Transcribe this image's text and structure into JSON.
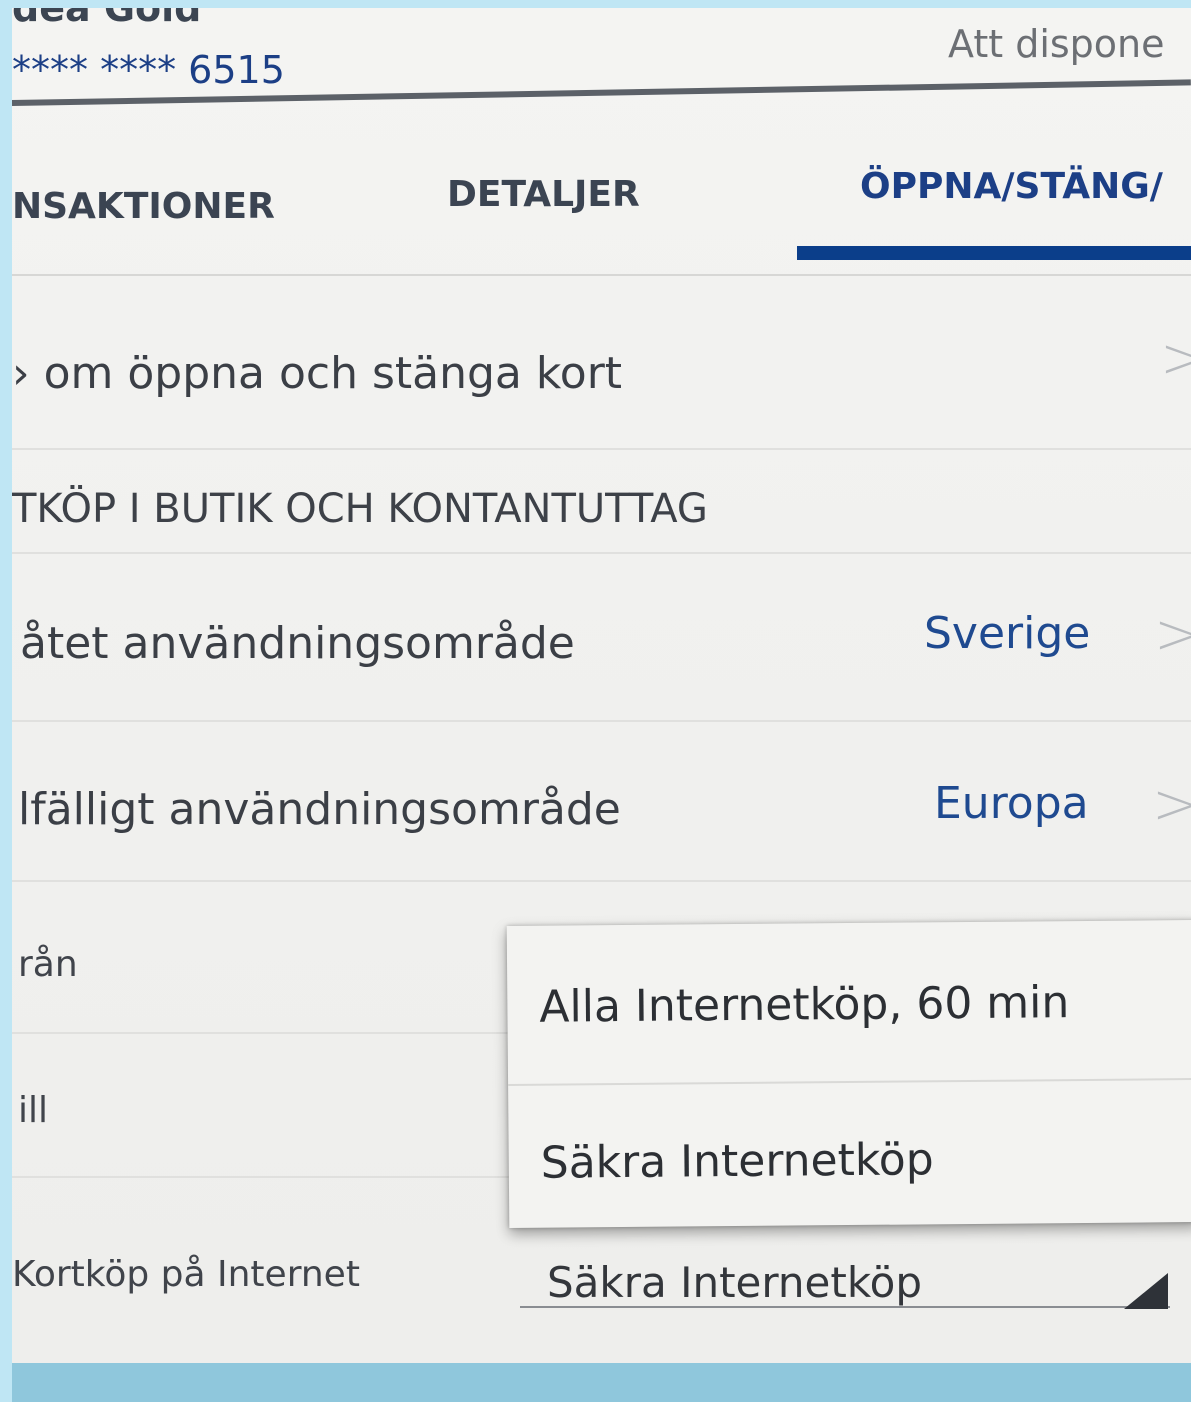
{
  "header": {
    "title": "dea Gold",
    "card_number": "**** **** 6515",
    "available_label": "Att dispone"
  },
  "tabs": [
    {
      "label": "NSAKTIONER",
      "active": false
    },
    {
      "label": "DETALJER",
      "active": false
    },
    {
      "label": "ÖPPNA/STÄNG/",
      "active": true
    }
  ],
  "rows": {
    "info_link": "om öppna och stänga kort",
    "section_heading": "TKÖP I BUTIK OCH KONTANTUTTAG",
    "allowed_area_label": "åtet användningsområde",
    "allowed_area_value": "Sverige",
    "temporary_area_label": "lfälligt användningsområde",
    "temporary_area_value": "Europa",
    "from_label": "rån",
    "to_label": "ill",
    "internet_label": "Kortköp på Internet",
    "internet_value": "Säkra Internetköp"
  },
  "dropdown": {
    "options": [
      "Alla Internetköp, 60 min",
      "Säkra Internetköp"
    ]
  },
  "icons": {
    "chevron": "chevron-right-icon",
    "select_arrow": "dropdown-triangle-icon"
  },
  "colors": {
    "accent": "#0b3e8a",
    "value_blue": "#1f4a90",
    "frame": "#bfe6f4"
  }
}
